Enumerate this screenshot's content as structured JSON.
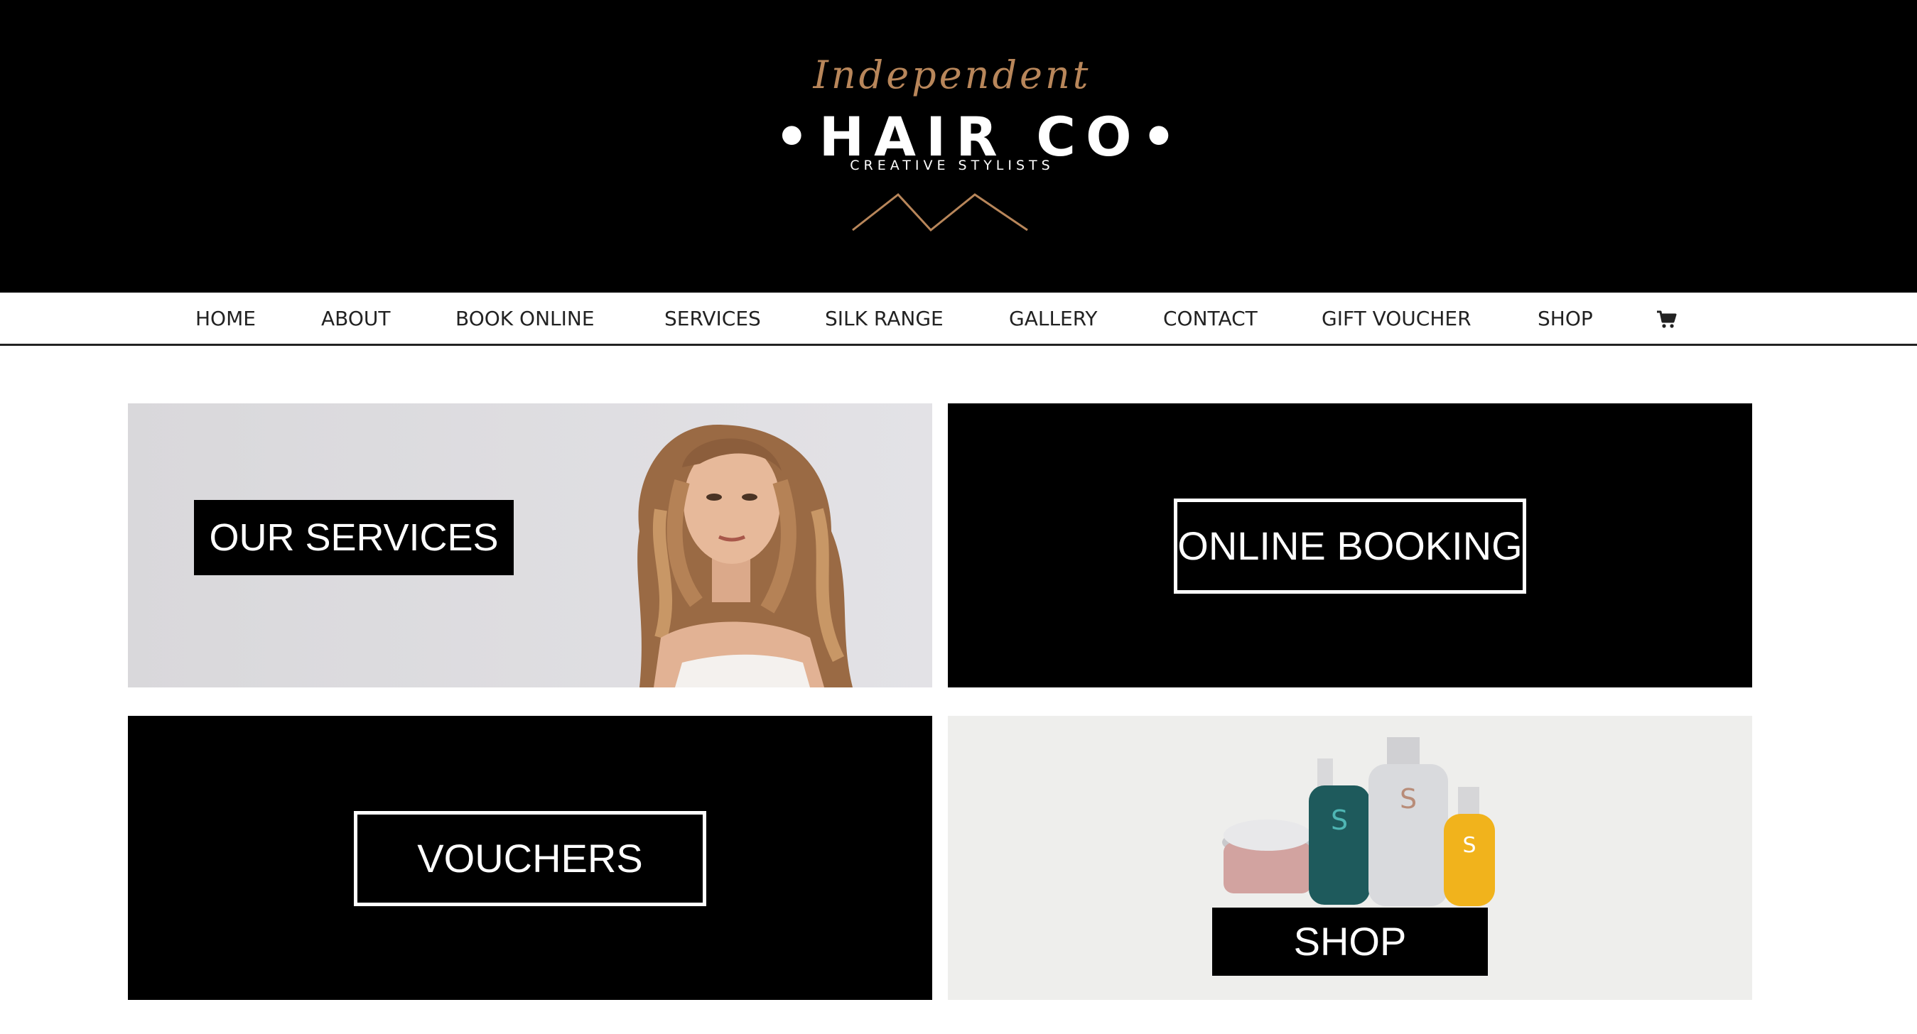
{
  "header": {
    "logo_script": "Independent",
    "logo_main": "•HAIR CO•",
    "logo_tagline": "CREATIVE STYLISTS"
  },
  "nav": {
    "items": [
      {
        "label": "HOME"
      },
      {
        "label": "ABOUT"
      },
      {
        "label": "BOOK ONLINE"
      },
      {
        "label": "SERVICES"
      },
      {
        "label": "SILK RANGE"
      },
      {
        "label": "GALLERY"
      },
      {
        "label": "CONTACT"
      },
      {
        "label": "GIFT VOUCHER"
      },
      {
        "label": "SHOP"
      }
    ],
    "cart_icon": "cart-icon"
  },
  "tiles": {
    "services": {
      "label": "OUR SERVICES"
    },
    "booking": {
      "label": "ONLINE BOOKING"
    },
    "vouchers": {
      "label": "VOUCHERS"
    },
    "shop": {
      "label": "SHOP"
    }
  },
  "colors": {
    "header_bg": "#000000",
    "logo_accent": "#b8865a",
    "nav_text": "#222222"
  }
}
